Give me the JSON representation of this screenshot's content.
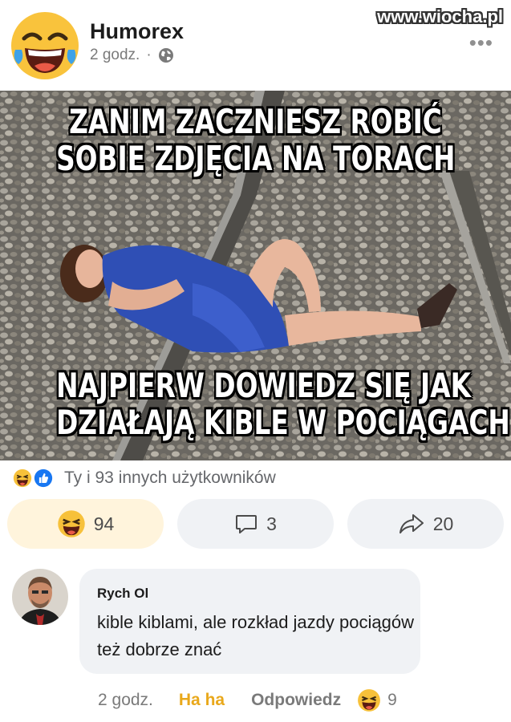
{
  "header": {
    "page_name": "Humorex",
    "time": "2 godz.",
    "separator": "·",
    "more_label": "•••",
    "watermark": "www.wiocha.pl"
  },
  "meme": {
    "top_line_1": "ZANIM ZACZNIESZ ROBIĆ",
    "top_line_2": "SOBIE ZDJĘCIA NA TORACH",
    "bottom_line_1": "NAJPIERW DOWIEDZ SIĘ JAK",
    "bottom_line_2": "DZIAŁAJĄ KIBLE W POCIĄGACH"
  },
  "reactions": {
    "summary": "Ty i 93 innych użytkowników",
    "icons": [
      "haha-icon",
      "like-icon"
    ]
  },
  "actions": {
    "react_count": "94",
    "comment_count": "3",
    "share_count": "20"
  },
  "comment": {
    "author": "Rych Ol",
    "text": "kible kiblami, ale rozkład jazdy pociągów też dobrze znać",
    "time": "2 godz.",
    "haha_label": "Ha ha",
    "reply_label": "Odpowiedz",
    "reaction_count": "9"
  },
  "colors": {
    "haha_yellow": "#f7c13a",
    "haha_accent": "#e9a81b",
    "like_blue": "#1877f2",
    "bubble_gray": "#f0f2f5",
    "react_button_bg": "#fff4dc"
  }
}
